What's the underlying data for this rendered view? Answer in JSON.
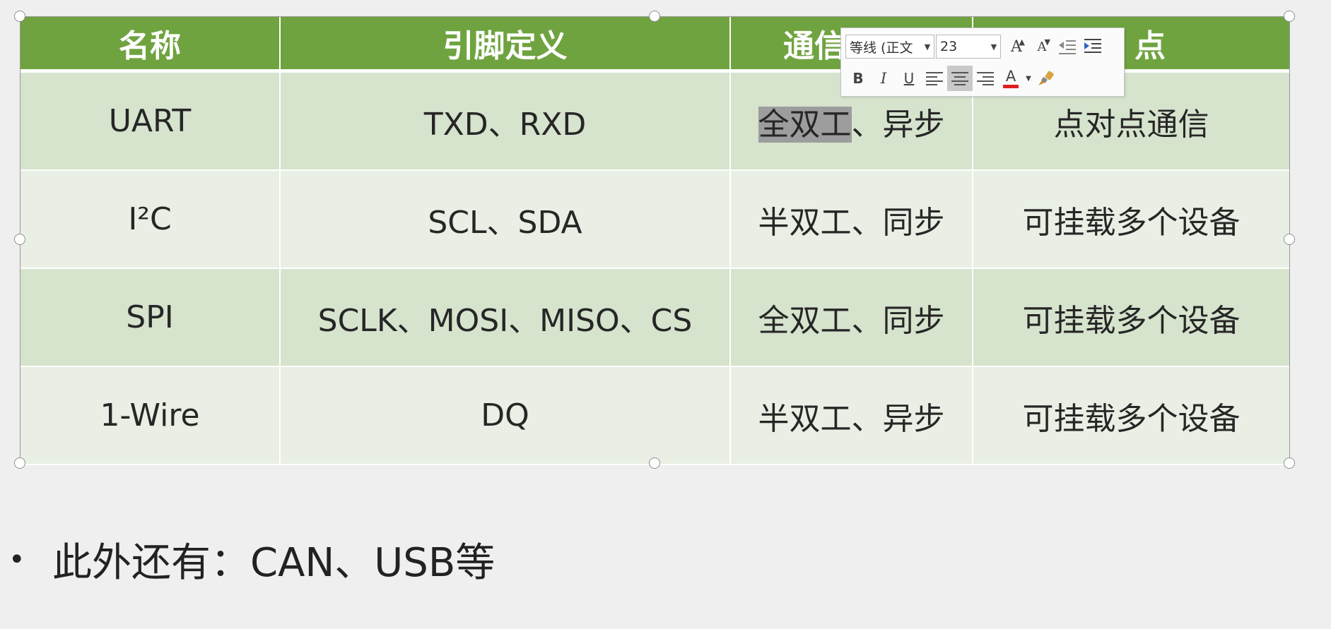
{
  "table": {
    "headers": [
      "名称",
      "引脚定义",
      "通信",
      "点"
    ],
    "rows": [
      [
        "UART",
        "TXD、RXD",
        "全双工、异步",
        "点对点通信"
      ],
      [
        "I²C",
        "SCL、SDA",
        "半双工、同步",
        "可挂载多个设备"
      ],
      [
        "SPI",
        "SCLK、MOSI、MISO、CS",
        "全双工、同步",
        "可挂载多个设备"
      ],
      [
        "1-Wire",
        "DQ",
        "半双工、异步",
        "可挂载多个设备"
      ]
    ],
    "selected_text": "全双工",
    "selected_rest": "、异步"
  },
  "toolbar": {
    "font_name": "等线 (正文",
    "font_size": "23",
    "bold": "B",
    "italic": "I",
    "underline": "U",
    "font_color_label": "A",
    "font_color": "#e02020",
    "grow_font": "A",
    "shrink_font": "A"
  },
  "note": {
    "bullet": "•",
    "text": "此外还有：CAN、USB等"
  },
  "colors": {
    "header_bg": "#6fa33f",
    "row_odd": "#d6e3cd",
    "row_even": "#e9efe4"
  }
}
